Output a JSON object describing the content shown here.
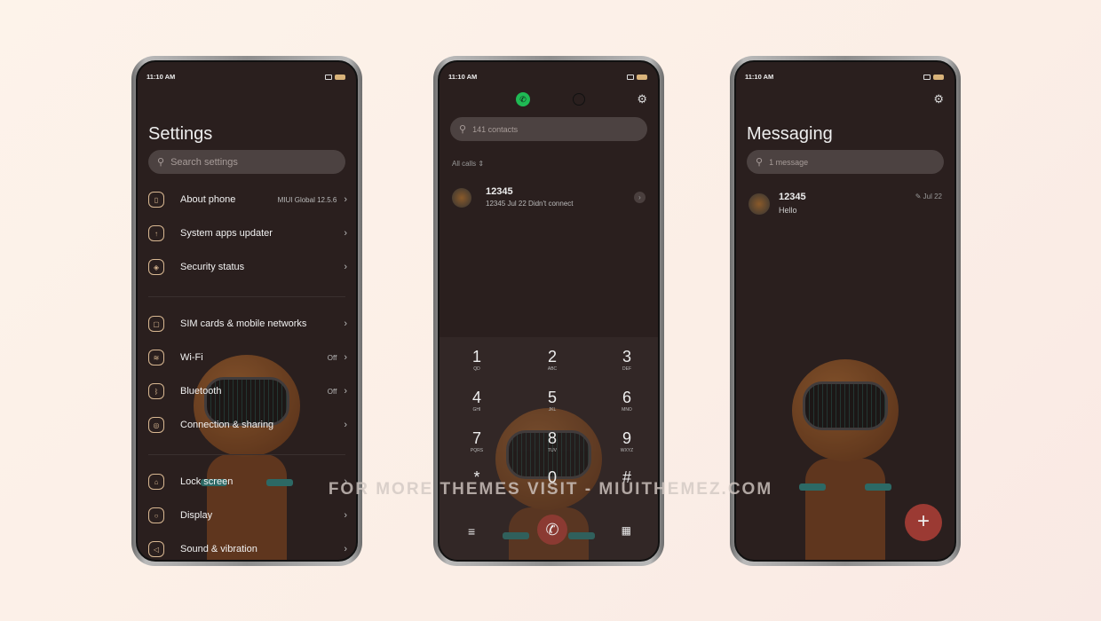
{
  "status": {
    "time": "11:10 AM"
  },
  "settings": {
    "title": "Settings",
    "search_placeholder": "Search settings",
    "items": [
      {
        "label": "About phone",
        "value": "MIUI Global 12.5.6",
        "icon": "phone-icon"
      },
      {
        "label": "System apps updater",
        "value": "",
        "icon": "update-icon"
      },
      {
        "label": "Security status",
        "value": "",
        "icon": "shield-icon"
      },
      {
        "label": "SIM cards & mobile networks",
        "value": "",
        "icon": "sim-icon"
      },
      {
        "label": "Wi-Fi",
        "value": "Off",
        "icon": "wifi-icon"
      },
      {
        "label": "Bluetooth",
        "value": "Off",
        "icon": "bluetooth-icon"
      },
      {
        "label": "Connection & sharing",
        "value": "",
        "icon": "connection-icon"
      },
      {
        "label": "Lock screen",
        "value": "",
        "icon": "lock-icon"
      },
      {
        "label": "Display",
        "value": "",
        "icon": "display-icon"
      },
      {
        "label": "Sound & vibration",
        "value": "",
        "icon": "sound-icon"
      }
    ]
  },
  "dialer": {
    "search_placeholder": "141 contacts",
    "filter": "All calls",
    "call": {
      "name": "12345",
      "detail": "12345 Jul 22 Didn't connect"
    },
    "keys": [
      {
        "d": "1",
        "l": "QD"
      },
      {
        "d": "2",
        "l": "ABC"
      },
      {
        "d": "3",
        "l": "DEF"
      },
      {
        "d": "4",
        "l": "GHI"
      },
      {
        "d": "5",
        "l": "JKL"
      },
      {
        "d": "6",
        "l": "MNO"
      },
      {
        "d": "7",
        "l": "PQRS"
      },
      {
        "d": "8",
        "l": "TUV"
      },
      {
        "d": "9",
        "l": "WXYZ"
      },
      {
        "d": "*",
        "l": ""
      },
      {
        "d": "0",
        "l": "+"
      },
      {
        "d": "#",
        "l": ""
      }
    ],
    "accent": "#1fb954",
    "call_button_color": "#8b3a32"
  },
  "messaging": {
    "title": "Messaging",
    "search_placeholder": "1 message",
    "thread": {
      "name": "12345",
      "preview": "Hello",
      "date": "Jul 22"
    },
    "fab_color": "#9b3a33"
  },
  "watermark": "FOR MORE THEMES VISIT - MIUITHEMEZ.COM"
}
